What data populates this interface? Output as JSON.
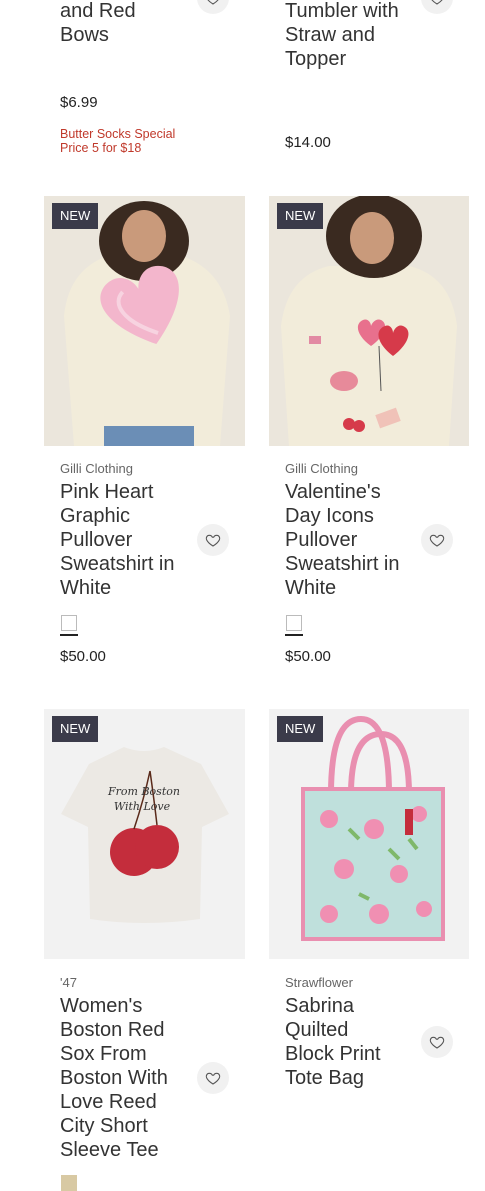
{
  "row0": {
    "left": {
      "title_lines": [
        "and Red",
        "Bows"
      ],
      "price": "$6.99",
      "promo": [
        "Butter Socks Special",
        "Price 5 for $18"
      ]
    },
    "right": {
      "title_lines": [
        "Tumbler with",
        "Straw and",
        "Topper"
      ],
      "price": "$14.00"
    }
  },
  "row1": {
    "left": {
      "badge": "NEW",
      "brand": "Gilli Clothing",
      "title_lines": [
        "Pink Heart",
        "Graphic",
        "Pullover",
        "Sweatshirt in",
        "White"
      ],
      "price": "$50.00"
    },
    "right": {
      "badge": "NEW",
      "brand": "Gilli Clothing",
      "title_lines": [
        "Valentine's",
        "Day Icons",
        "Pullover",
        "Sweatshirt in",
        "White"
      ],
      "price": "$50.00"
    }
  },
  "row2": {
    "left": {
      "badge": "NEW",
      "brand": "'47",
      "title_lines": [
        "Women's",
        "Boston Red",
        "Sox From",
        "Boston With",
        "Love Reed",
        "City Short",
        "Sleeve Tee"
      ],
      "tee_text": [
        "From Boston",
        "With Love"
      ]
    },
    "right": {
      "badge": "NEW",
      "brand": "Strawflower",
      "title_lines": [
        "Sabrina",
        "Quilted",
        "Block Print",
        "Tote Bag"
      ]
    }
  },
  "colors": {
    "badge_bg": "#3b3b4a",
    "promo": "#c0392b",
    "sweatshirt": "#f1ead3",
    "swatch_tan": "#d8c9a3"
  },
  "icons": {
    "wishlist": "heart-outline-icon"
  }
}
